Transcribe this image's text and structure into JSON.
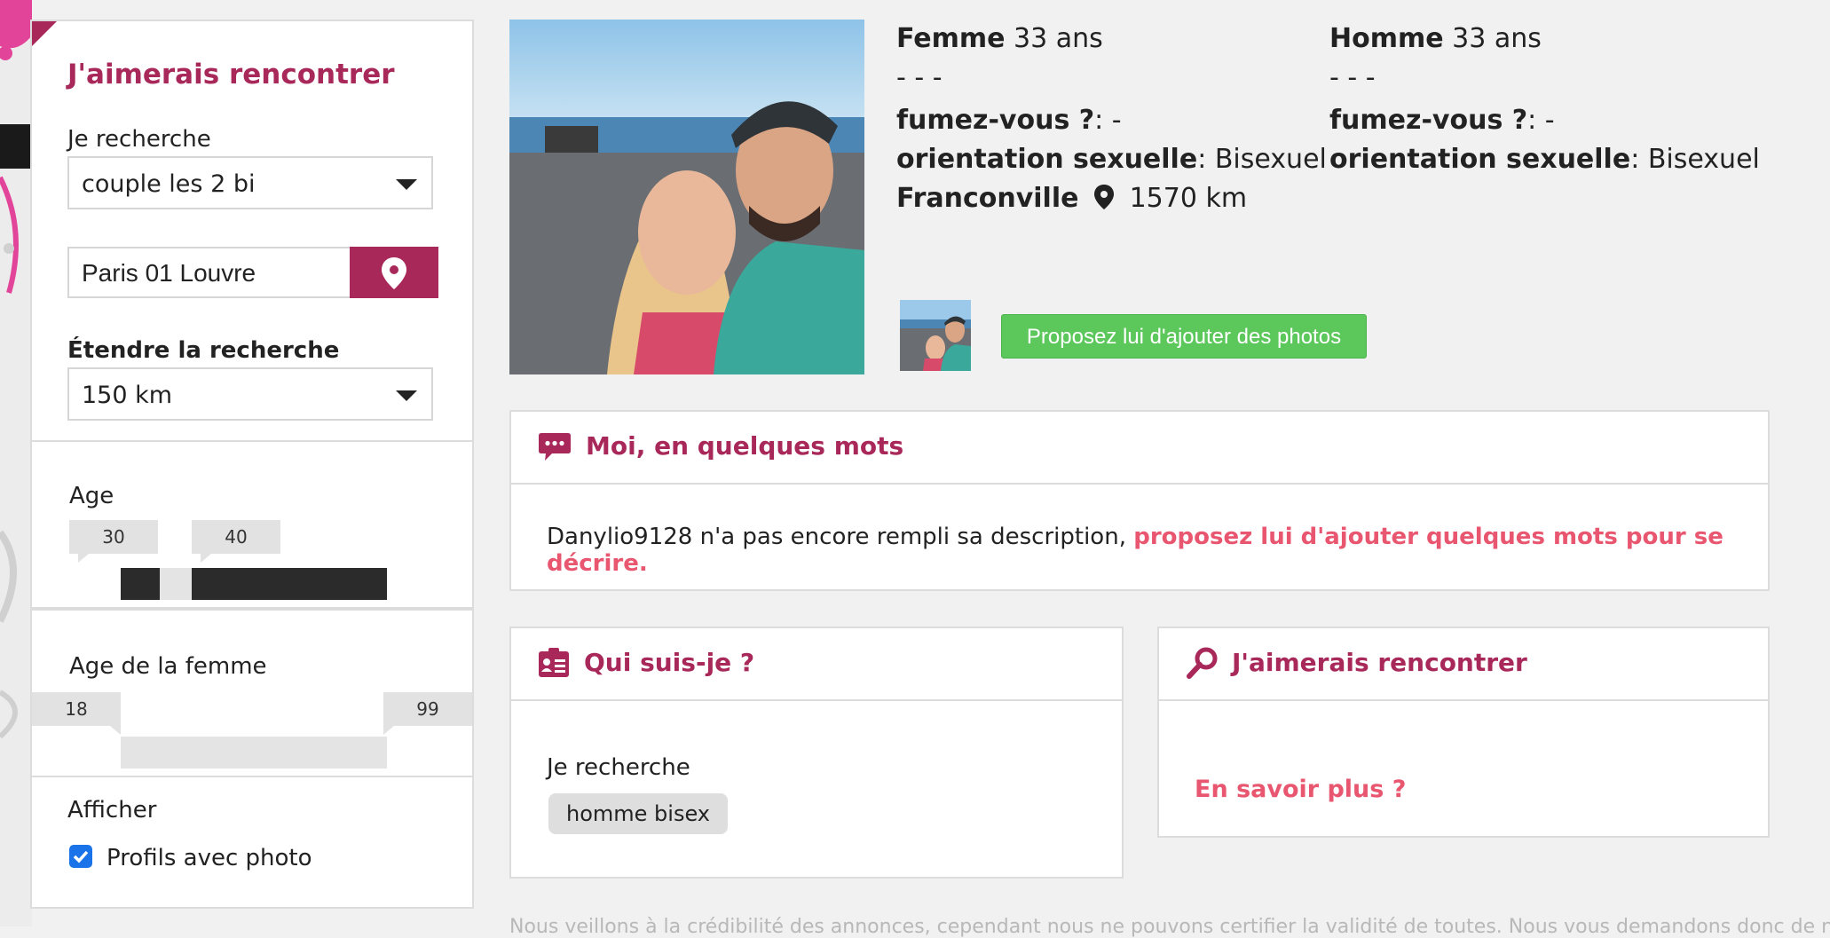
{
  "colors": {
    "brand": "#a8285a",
    "link": "#e8566f",
    "green": "#5cc85c",
    "slider_dark": "#2b2b2b"
  },
  "sidebar": {
    "title": "J'aimerais rencontrer",
    "search_label": "Je recherche",
    "search_value": "couple les 2 bi",
    "location_value": "Paris 01 Louvre",
    "extend_label": "Étendre la recherche",
    "extend_value": "150 km",
    "age": {
      "label": "Age",
      "min": "30",
      "max": "40"
    },
    "age_woman": {
      "label": "Age de la femme",
      "min": "18",
      "max": "99"
    },
    "show_label": "Afficher",
    "photo_checkbox_label": "Profils avec photo",
    "photo_checkbox_checked": true
  },
  "profile": {
    "woman": {
      "gender": "Femme",
      "age": "33 ans",
      "dashes": "- - -",
      "smoke_label": "fumez-vous ?",
      "smoke_value": ": -",
      "orientation_label": "orientation sexuelle",
      "orientation_value": ": Bisexuel"
    },
    "man": {
      "gender": "Homme",
      "age": "33 ans",
      "dashes": "- - -",
      "smoke_label": "fumez-vous ?",
      "smoke_value": ": -",
      "orientation_label": "orientation sexuelle",
      "orientation_value": ": Bisexuel"
    },
    "city": "Franconville",
    "distance": "1570 km",
    "add_photos_button": "Proposez lui d'ajouter des photos"
  },
  "about": {
    "title": "Moi, en quelques mots",
    "text": "Danylio9128 n'a pas encore rempli sa description, ",
    "link": "proposez lui d'ajouter quelques mots pour se décrire."
  },
  "who": {
    "title": "Qui suis-je ?",
    "search_label": "Je recherche",
    "search_tag": "homme bisex"
  },
  "meet": {
    "title": "J'aimerais rencontrer",
    "more_link": "En savoir plus ?"
  },
  "footer": {
    "notice": "Nous veillons à la crédibilité des annonces, cependant nous ne pouvons certifier la validité de toutes. Nous vous demandons donc de nous"
  }
}
